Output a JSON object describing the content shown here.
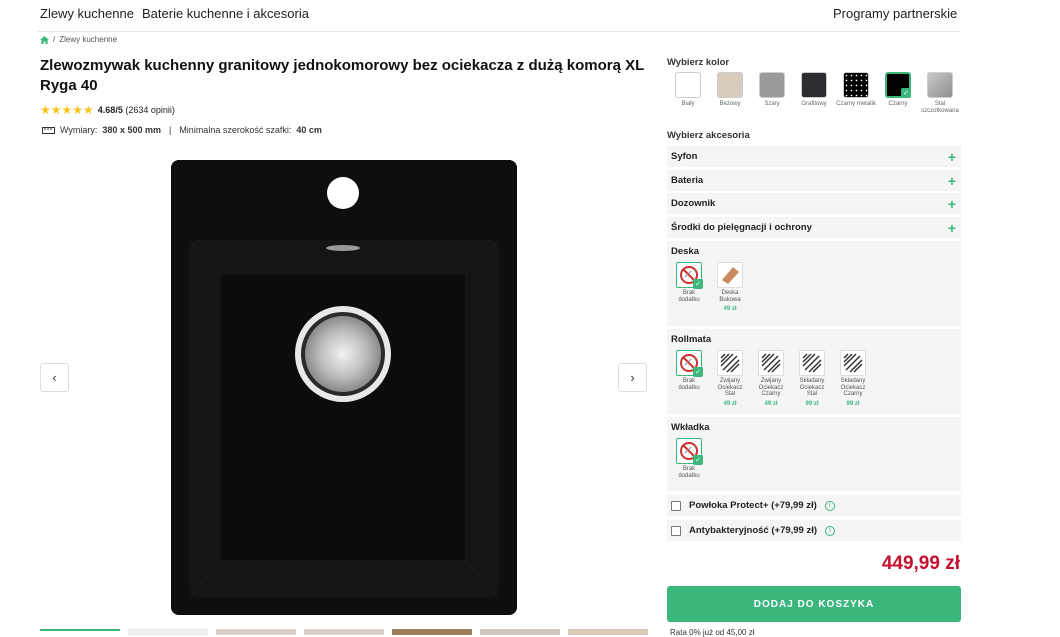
{
  "nav": {
    "link1": "Zlewy kuchenne",
    "link2": "Baterie kuchenne i akcesoria",
    "link3": "Programy partnerskie"
  },
  "breadcrumb": {
    "sep": "/",
    "current": "Zlewy kuchenne"
  },
  "product": {
    "title": "Zlewozmywak kuchenny granitowy jednokomorowy bez ociekacza z dużą komorą XL Ryga 40",
    "rating": "4.68/5",
    "reviews": "(2634 opinii)",
    "stars": "★★★★★",
    "dims_label": "Wymiary:",
    "dims_value": "380 x 500 mm",
    "cab_label": "Minimalna szerokość szafki:",
    "cab_value": "40 cm",
    "divider": "|"
  },
  "gallery": {
    "prev": "‹",
    "next": "›"
  },
  "color": {
    "title": "Wybierz kolor",
    "options": [
      {
        "label": "Biały",
        "hex": "#ffffff"
      },
      {
        "label": "Beżowy",
        "hex": "#d8ccbf"
      },
      {
        "label": "Szary",
        "hex": "#9a9a9a"
      },
      {
        "label": "Grafitowy",
        "hex": "#2b2d33"
      },
      {
        "label": "Czarny metalik",
        "hex": "#050505"
      },
      {
        "label": "Czarny",
        "hex": "#000000"
      },
      {
        "label": "Stal szczotkowana",
        "hex": "#a7a7a7"
      }
    ],
    "selected": "Czarny"
  },
  "accessories": {
    "title": "Wybierz akcesoria",
    "rows": [
      "Syfon",
      "Bateria",
      "Dozownik",
      "Środki do pielęgnacji i ochrony"
    ],
    "plus": "+"
  },
  "deska": {
    "title": "Deska",
    "options": [
      {
        "label": "Brak\ndodatku",
        "price": ""
      },
      {
        "label": "Deska\nBukowa",
        "price": "49 zł"
      }
    ]
  },
  "rollmata": {
    "title": "Rollmata",
    "options": [
      {
        "label": "Brak\ndodatku",
        "price": ""
      },
      {
        "label": "Zwijany\nOciekacz\nStal",
        "price": "49 zł"
      },
      {
        "label": "Zwijany\nOciekacz\nCzarny",
        "price": "49 zł"
      },
      {
        "label": "Składany\nOciekacz\nStal",
        "price": "99 zł"
      },
      {
        "label": "Składany\nOciekacz\nCzarny",
        "price": "99 zł"
      }
    ]
  },
  "wkladka": {
    "title": "Wkładka",
    "options": [
      {
        "label": "Brak\ndodatku",
        "price": ""
      }
    ]
  },
  "extras": [
    {
      "label": "Powłoka Protect+ (+79,99 zł)"
    },
    {
      "label": "Antybakteryjność (+79,99 zł)"
    }
  ],
  "info_glyph": "i",
  "check_glyph": "✓",
  "price": "449,99 zł",
  "cart_button": "DODAJ DO KOSZYKA",
  "rata": "Rata 0% już od 45,00 zł",
  "colors": {
    "accent": "#3bb77e",
    "price": "#c8102e"
  }
}
